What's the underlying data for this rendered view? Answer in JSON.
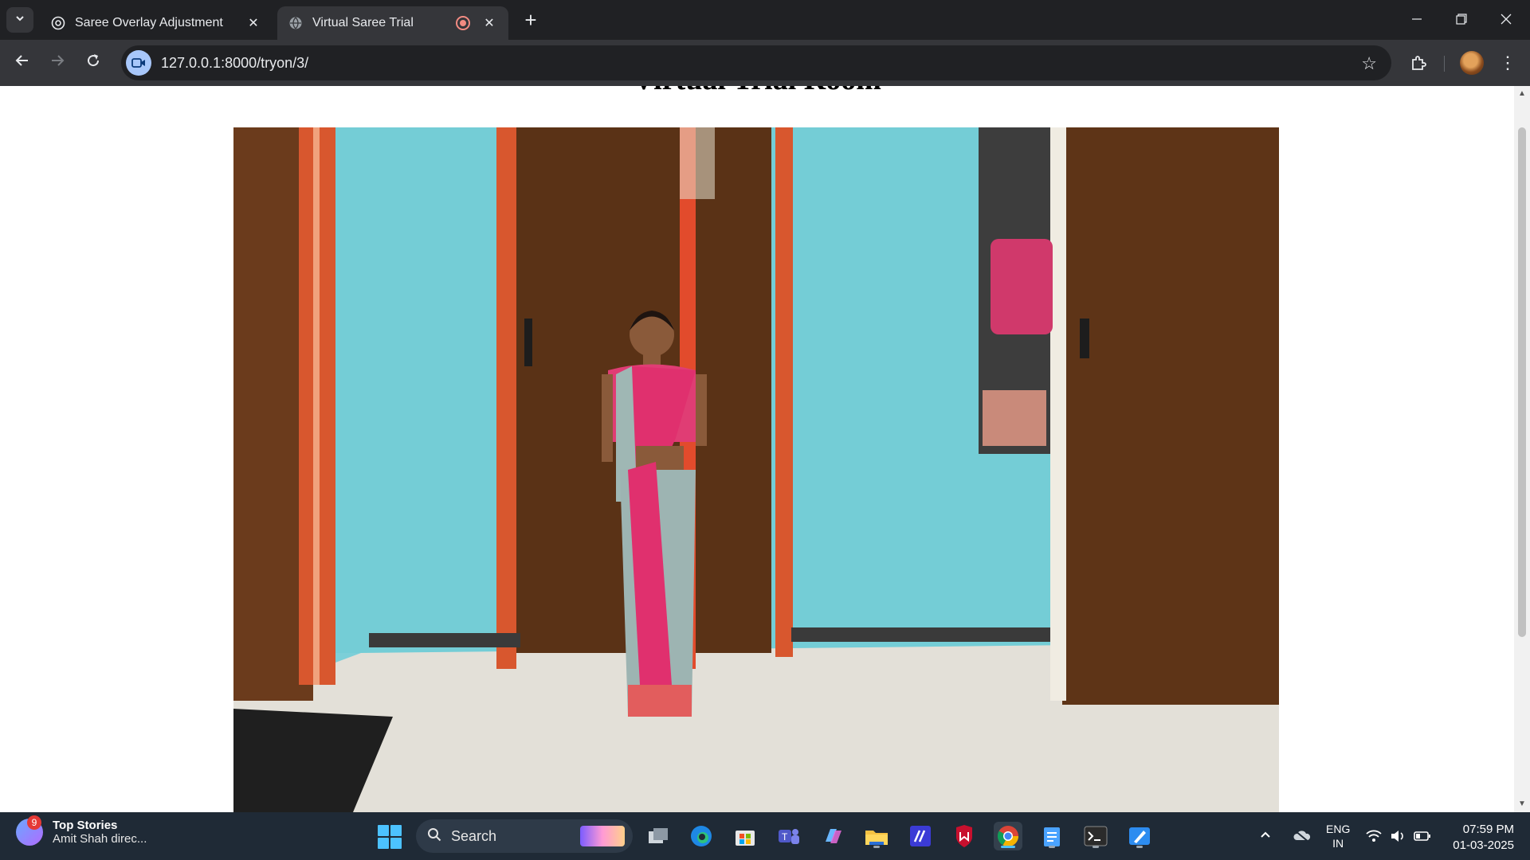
{
  "browser": {
    "tabs": [
      {
        "title": "Saree Overlay Adjustment",
        "active": false
      },
      {
        "title": "Virtual Saree Trial",
        "active": true,
        "recording": true
      }
    ],
    "url": "127.0.0.1:8000/tryon/3/"
  },
  "page": {
    "title": "Virtual Trial Room"
  },
  "taskbar": {
    "news_badge": "9",
    "news_title": "Top Stories",
    "news_headline": "Amit Shah direc...",
    "search_placeholder": "Search",
    "lang_line1": "ENG",
    "lang_line2": "IN",
    "time": "07:59 PM",
    "date": "01-03-2025"
  },
  "colors": {
    "browser_frame": "#202124",
    "toolbar": "#35363a",
    "accent": "#4cc2ff",
    "recording": "#f28b82"
  }
}
